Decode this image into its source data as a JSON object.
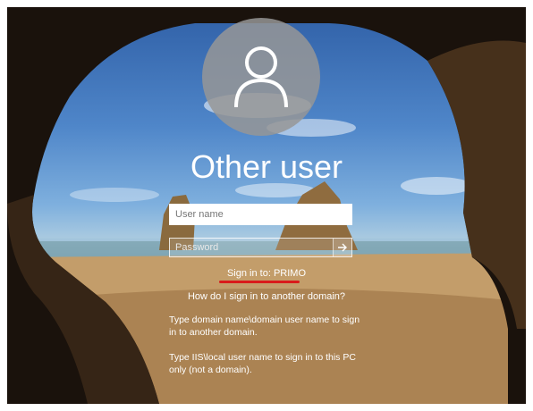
{
  "user": {
    "title": "Other user",
    "avatar_icon": "person-icon"
  },
  "form": {
    "username_placeholder": "User name",
    "username_value": "",
    "password_placeholder": "Password",
    "password_value": "",
    "submit_icon": "arrow-right-icon"
  },
  "sign_in": {
    "target_text": "Sign in to: PRIMO",
    "help_link": "How do I sign in to another domain?",
    "hint_domain": "Type domain name\\domain user name to sign in to another domain.",
    "hint_local": "Type IIS\\local user name to sign in to this PC only (not a domain)."
  },
  "colors": {
    "underline": "#d91b1b",
    "avatar_bg": "#969696",
    "text": "#ffffff"
  }
}
